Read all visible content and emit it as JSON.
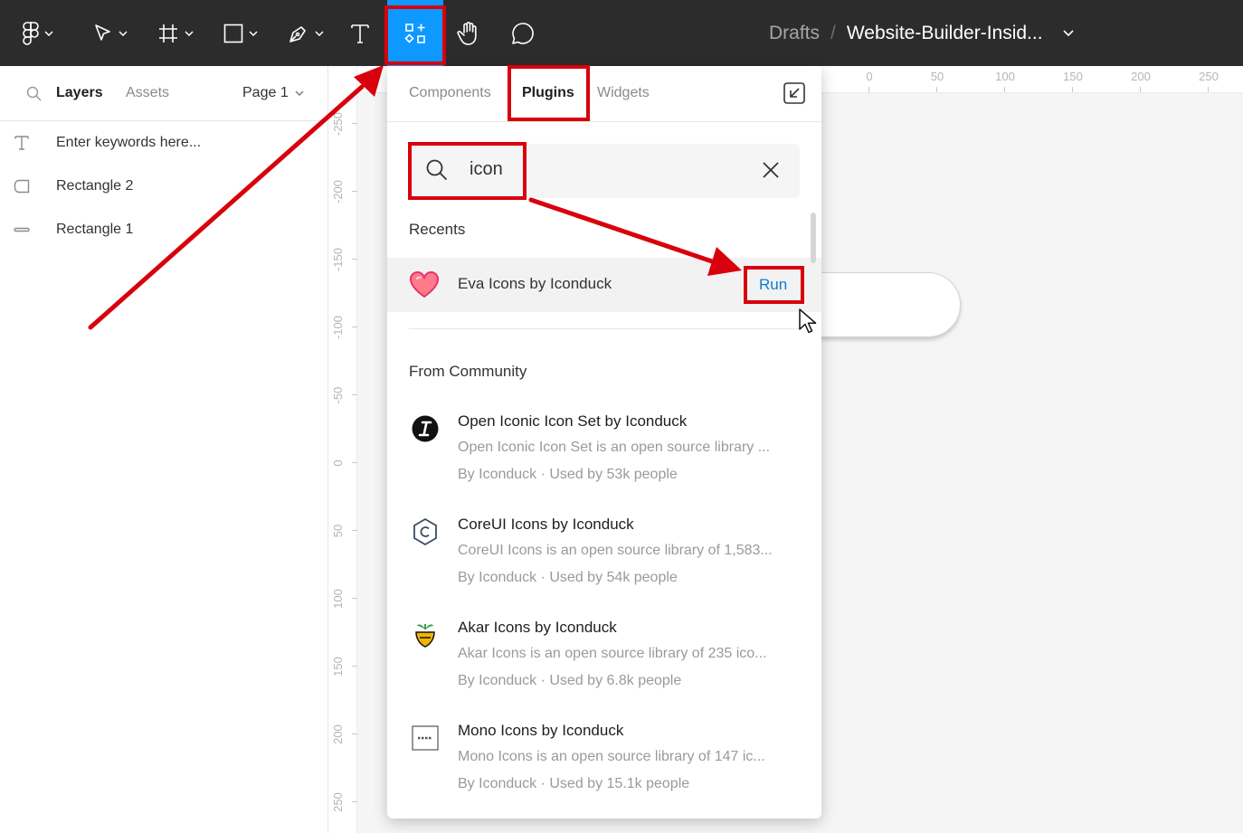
{
  "toolbar": {
    "breadcrumb": {
      "folder": "Drafts",
      "separator": "/",
      "file": "Website-Builder-Insid..."
    }
  },
  "left_panel": {
    "tabs": [
      {
        "label": "Layers"
      },
      {
        "label": "Assets"
      }
    ],
    "page_selector": "Page 1",
    "layers": [
      {
        "name": "Enter keywords here...",
        "icon": "text-layer-icon"
      },
      {
        "name": "Rectangle 2",
        "icon": "rectangle-layer-icon"
      },
      {
        "name": "Rectangle 1",
        "icon": "line-layer-icon"
      }
    ]
  },
  "rulers": {
    "horizontal": [
      "0",
      "50",
      "100",
      "150",
      "200",
      "250"
    ],
    "vertical": [
      "-250",
      "-200",
      "-150",
      "-100",
      "-50",
      "0",
      "50",
      "100",
      "150",
      "200",
      "250"
    ]
  },
  "plugins_panel": {
    "tabs": [
      {
        "label": "Components"
      },
      {
        "label": "Plugins"
      },
      {
        "label": "Widgets"
      }
    ],
    "search": {
      "value": "icon"
    },
    "recents_heading": "Recents",
    "recent": {
      "name": "Eva Icons by Iconduck",
      "action": "Run",
      "icon": "heart-icon"
    },
    "community_heading": "From Community",
    "community": [
      {
        "name": "Open Iconic Icon Set by Iconduck",
        "description": "Open Iconic Icon Set is an open source library ...",
        "meta": "By Iconduck · Used by 53k people",
        "icon": "open-iconic-logo-icon"
      },
      {
        "name": "CoreUI Icons by Iconduck",
        "description": "CoreUI Icons is an open source library of 1,583...",
        "meta": "By Iconduck · Used by 54k people",
        "icon": "coreui-logo-icon"
      },
      {
        "name": "Akar Icons by Iconduck",
        "description": "Akar Icons is an open source library of 235 ico...",
        "meta": "By Iconduck · Used by 6.8k people",
        "icon": "akar-logo-icon"
      },
      {
        "name": "Mono Icons by Iconduck",
        "description": "Mono Icons is an open source library of 147 ic...",
        "meta": "By Iconduck · Used by 15.1k people",
        "icon": "mono-logo-icon"
      }
    ]
  },
  "colors": {
    "toolbar_bg": "#2c2c2c",
    "accent_blue": "#0d99ff",
    "annotation_red": "#d8000c",
    "run_link": "#0c7dd6"
  }
}
